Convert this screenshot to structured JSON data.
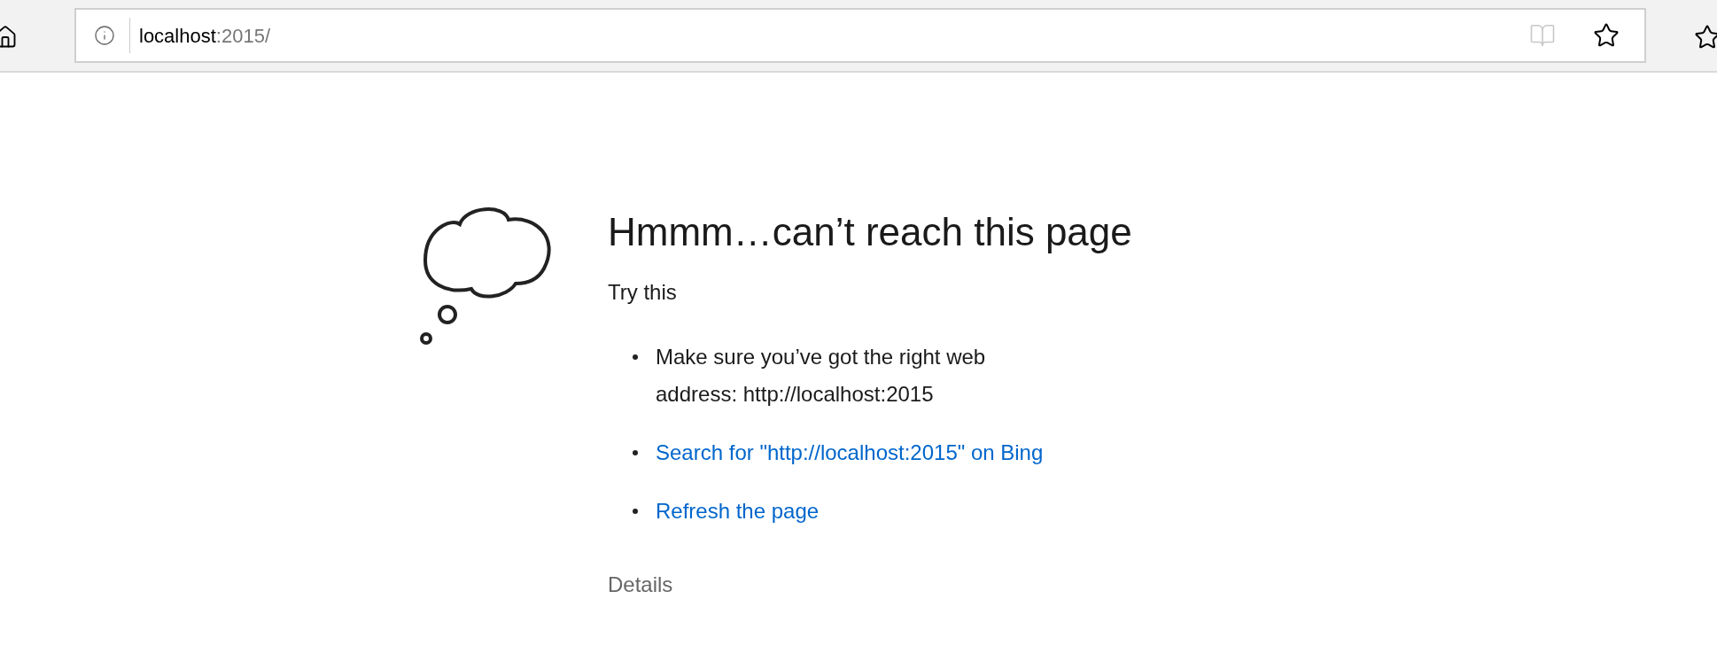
{
  "address_bar": {
    "host": "localhost",
    "rest": ":2015/"
  },
  "heading": "Hmmm…can’t reach this page",
  "subheading": "Try this",
  "suggestions": [
    {
      "kind": "text",
      "text": "Make sure you’ve got the right web address: http://localhost:2015"
    },
    {
      "kind": "link",
      "text": "Search for \"http://localhost:2015\" on Bing"
    },
    {
      "kind": "link",
      "text": "Refresh the page"
    }
  ],
  "details": "Details"
}
